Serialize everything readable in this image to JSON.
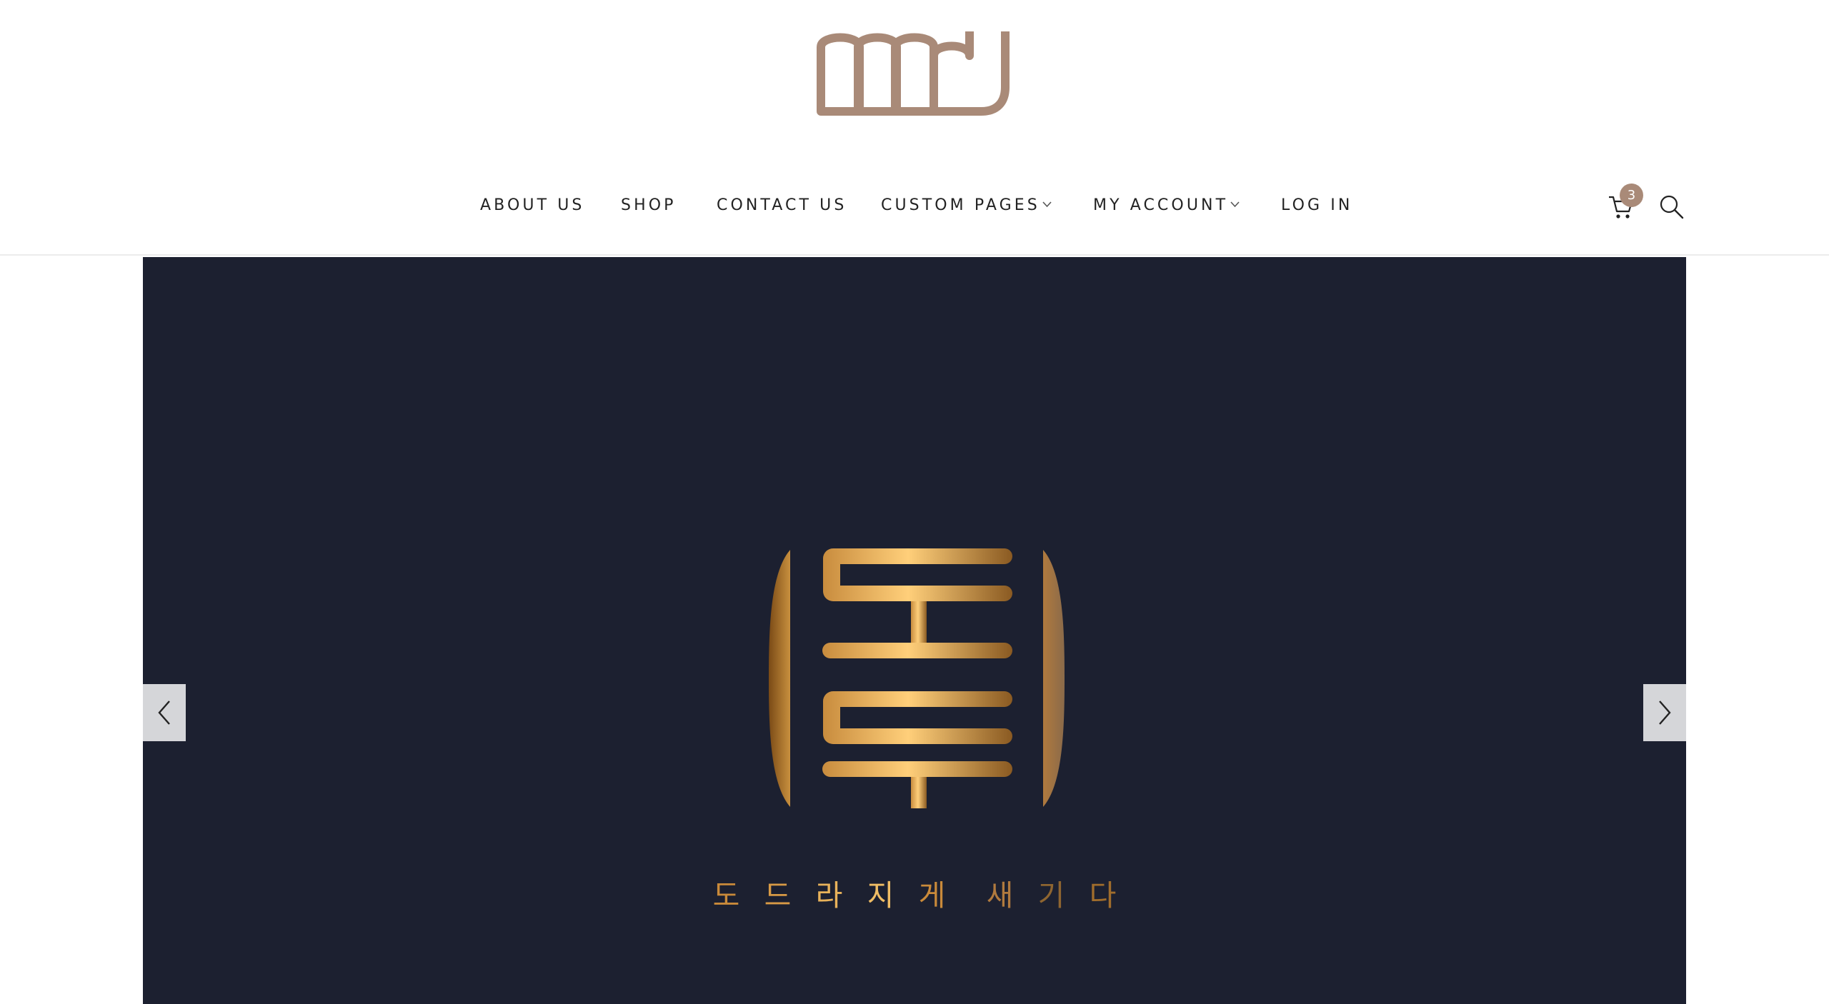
{
  "header": {
    "brand": "DDU",
    "brand_color": "#a98a78",
    "nav": [
      {
        "label": "ABOUT US",
        "dropdown": false
      },
      {
        "label": "SHOP",
        "dropdown": false
      },
      {
        "label": "CONTACT US",
        "dropdown": false
      },
      {
        "label": "CUSTOM PAGES",
        "dropdown": true
      },
      {
        "label": "MY ACCOUNT",
        "dropdown": true
      },
      {
        "label": "LOG IN",
        "dropdown": false
      }
    ],
    "cart_count": "3",
    "icons": {
      "cart": "shopping-cart-icon",
      "search": "search-icon",
      "dropdown": "chevron-down-icon"
    }
  },
  "hero": {
    "background": "#1c2030",
    "emblem": "도두",
    "tagline": [
      "도",
      "드",
      "라",
      "지",
      "게",
      "새",
      "기",
      "다"
    ],
    "tagline_colors": [
      "#c98a3a",
      "#d89a45",
      "#e8b25a",
      "#f0bd65",
      "#c98a3a",
      "#b07a3e",
      "#8e6530",
      "#a06d2c"
    ],
    "prev_icon": "chevron-left-icon",
    "next_icon": "chevron-right-icon"
  }
}
